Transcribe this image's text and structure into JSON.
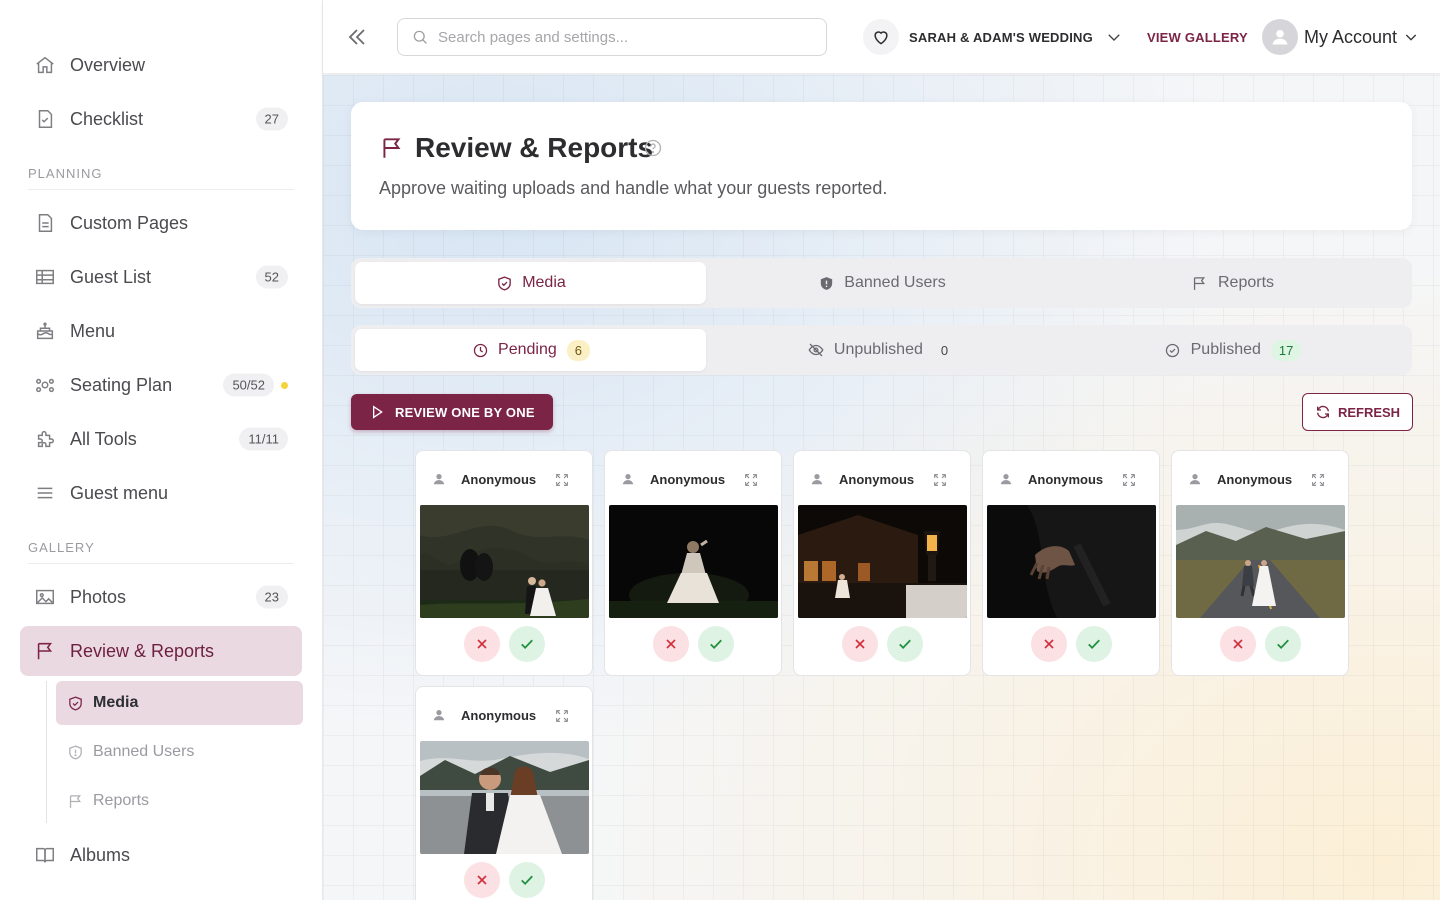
{
  "sidebar": {
    "items": [
      {
        "label": "Overview"
      },
      {
        "label": "Checklist",
        "badge": "27"
      },
      {
        "section": "PLANNING"
      },
      {
        "label": "Custom Pages"
      },
      {
        "label": "Guest List",
        "badge": "52"
      },
      {
        "label": "Menu"
      },
      {
        "label": "Seating Plan",
        "badge": "50/52",
        "dot": true
      },
      {
        "label": "All Tools",
        "badge": "11/11"
      },
      {
        "label": "Guest menu"
      },
      {
        "section": "GALLERY"
      },
      {
        "label": "Photos",
        "badge": "23"
      },
      {
        "label": "Review & Reports",
        "active": true
      },
      {
        "label": "Albums"
      }
    ],
    "planning_section": "PLANNING",
    "gallery_section": "GALLERY",
    "sub_items": [
      {
        "label": "Media",
        "active": true
      },
      {
        "label": "Banned Users"
      },
      {
        "label": "Reports"
      }
    ]
  },
  "topbar": {
    "search_placeholder": "Search pages and settings...",
    "event_name": "SARAH & ADAM'S WEDDING",
    "view_gallery": "VIEW GALLERY",
    "account_label": "My Account"
  },
  "header": {
    "title": "Review & Reports",
    "subtitle": "Approve waiting uploads and handle what your guests reported."
  },
  "tabs": [
    {
      "label": "Media",
      "active": true
    },
    {
      "label": "Banned Users"
    },
    {
      "label": "Reports"
    }
  ],
  "subtabs": [
    {
      "label": "Pending",
      "count": "6",
      "active": true
    },
    {
      "label": "Unpublished",
      "count": "0"
    },
    {
      "label": "Published",
      "count": "17"
    }
  ],
  "actions": {
    "review_one_by_one": "REVIEW ONE BY ONE",
    "refresh": "REFRESH"
  },
  "cards": [
    {
      "uploader": "Anonymous",
      "photo": "couple-by-rock-wall-at-night"
    },
    {
      "uploader": "Anonymous",
      "photo": "bride-in-spotlight-at-night"
    },
    {
      "uploader": "Anonymous",
      "photo": "couple-by-lantern-cabin"
    },
    {
      "uploader": "Anonymous",
      "photo": "hands-on-dark-suit"
    },
    {
      "uploader": "Anonymous",
      "photo": "couple-walking-on-mountain-road"
    },
    {
      "uploader": "Anonymous",
      "photo": "couple-sitting-back-to-back"
    }
  ],
  "colors": {
    "accent": "#7b2446",
    "accent_soft": "#ead9e0",
    "approve": "#23903f",
    "reject": "#d12e3c",
    "pending_badge": "#fbf0c5",
    "published_badge": "#dff5e3"
  }
}
